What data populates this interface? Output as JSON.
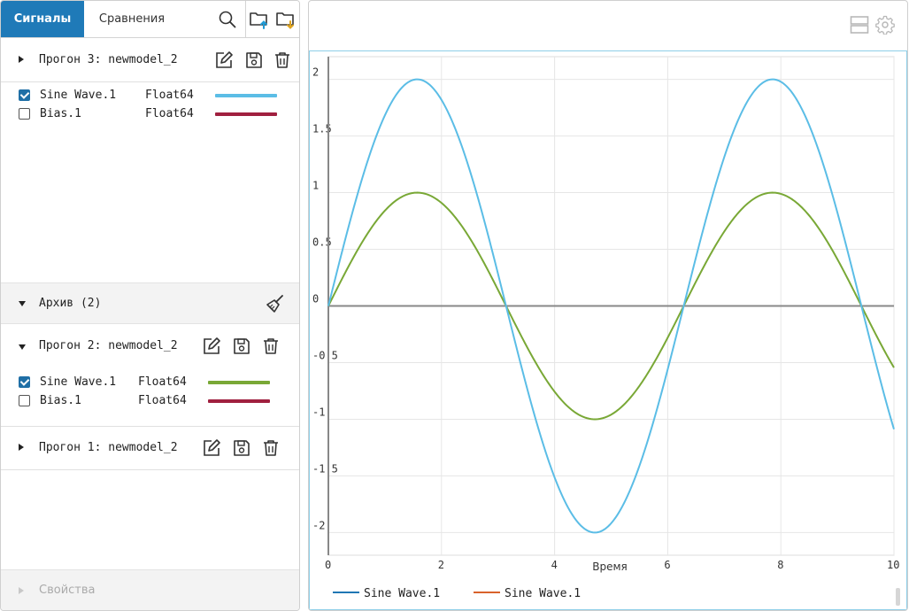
{
  "tabs": {
    "signals": "Сигналы",
    "compare": "Сравнения"
  },
  "icons": {
    "search": "search-icon",
    "folder_upload": "folder-upload-icon",
    "folder_download": "folder-download-icon",
    "edit": "edit-icon",
    "save": "save-icon",
    "trash": "trash-icon",
    "broom": "broom-icon",
    "layout": "layout-icon",
    "gear": "gear-icon"
  },
  "current_run": {
    "title": "Прогон 3: newmodel_2",
    "signals": [
      {
        "name": "Sine Wave.1",
        "type": "Float64",
        "checked": true,
        "color": "#5bbde6"
      },
      {
        "name": "Bias.1",
        "type": "Float64",
        "checked": false,
        "color": "#a0203f"
      }
    ]
  },
  "archive": {
    "label": "Архив (2)",
    "runs": [
      {
        "title": "Прогон 2: newmodel_2",
        "expanded": true,
        "signals": [
          {
            "name": "Sine Wave.1",
            "type": "Float64",
            "checked": true,
            "color": "#79a836"
          },
          {
            "name": "Bias.1",
            "type": "Float64",
            "checked": false,
            "color": "#a0203f"
          }
        ]
      },
      {
        "title": "Прогон 1: newmodel_2",
        "expanded": false,
        "signals": []
      }
    ]
  },
  "properties": {
    "label": "Свойства"
  },
  "chart_data": {
    "type": "line",
    "xlabel": "Время",
    "ylabel": "",
    "xlim": [
      0,
      10
    ],
    "ylim": [
      -2.2,
      2.2
    ],
    "x_ticks": [
      0,
      2,
      4,
      6,
      8,
      10
    ],
    "y_ticks": [
      2,
      1.5,
      1,
      0.5,
      0,
      -0.5,
      -1,
      -1.5,
      -2
    ],
    "grid": true,
    "legend_position": "bottom-left",
    "series": [
      {
        "name": "Sine Wave.1",
        "color": "#5bbde6",
        "legend_color": "#1f77b4",
        "formula": "2*sin(t)",
        "amplitude": 2
      },
      {
        "name": "Sine Wave.1",
        "color": "#79a836",
        "legend_color": "#d9622b",
        "formula": "sin(t)",
        "amplitude": 1
      }
    ]
  }
}
